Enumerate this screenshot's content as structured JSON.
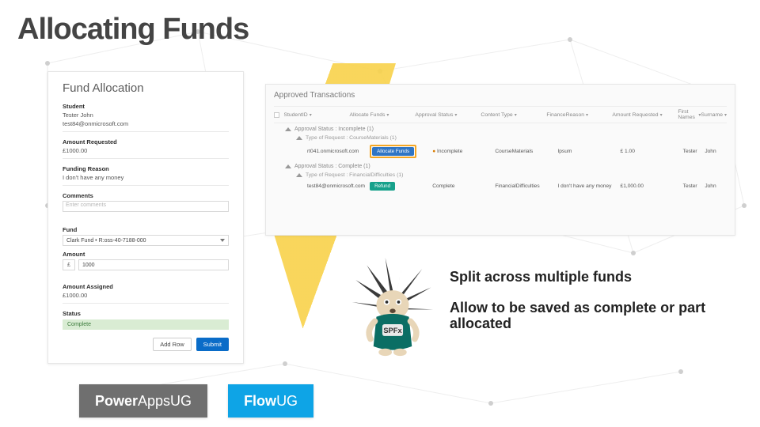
{
  "slide": {
    "title": "Allocating Funds"
  },
  "form": {
    "heading": "Fund Allocation",
    "student_label": "Student",
    "student_name": "Tester John",
    "student_email": "test84@onmicrosoft.com",
    "amount_requested_label": "Amount Requested",
    "amount_requested": "£1000.00",
    "funding_reason_label": "Funding Reason",
    "funding_reason": "I don't have any money",
    "comments_label": "Comments",
    "comments_placeholder": "Enter comments",
    "fund_label": "Fund",
    "fund_value": "Clark Fund • R:oss-40-7188-000",
    "amount_label": "Amount",
    "amount_currency": "£",
    "amount_value": "1000",
    "amount_assigned_label": "Amount Assigned",
    "amount_assigned": "£1000.00",
    "status_label": "Status",
    "status_value": "Complete",
    "add_row_label": "Add Row",
    "submit_label": "Submit"
  },
  "list": {
    "title": "Approved Transactions",
    "columns": {
      "c1": "StudentID",
      "c2": "Allocate Funds",
      "c3": "Approval Status",
      "c4": "Content Type",
      "c5": "FinanceReason",
      "c6": "Amount Requested",
      "c7": "First Names",
      "c8": "Surname"
    },
    "group1_status": "Approval Status : Incomplete (1)",
    "group1_type": "Type of Request : CourseMaterials (1)",
    "row1": {
      "email": "rt041.onmicrosoft.com",
      "allocate_btn": "Allocate Funds",
      "status": "Incomplete",
      "ctype": "CourseMaterials",
      "reason": "Ipsum",
      "amount": "£ 1.00",
      "first": "Tester",
      "last": "John"
    },
    "group2_status": "Approval Status : Complete (1)",
    "group2_type": "Type of Request : FinancialDifficulties (1)",
    "row2": {
      "email": "test84@onmicrosoft.com",
      "refund_btn": "Refund",
      "status": "Complete",
      "ctype": "FinancialDifficulties",
      "reason": "I don't have any money",
      "amount": "£1,000.00",
      "first": "Tester",
      "last": "John"
    }
  },
  "bullets": {
    "b1": "Split across multiple funds",
    "b2": "Allow to be saved as complete or part allocated"
  },
  "footer": {
    "logo1a": "Power",
    "logo1b": "AppsUG",
    "logo2a": "Flow",
    "logo2b": "UG"
  },
  "mascot": {
    "shirt_text": "SPFx"
  }
}
